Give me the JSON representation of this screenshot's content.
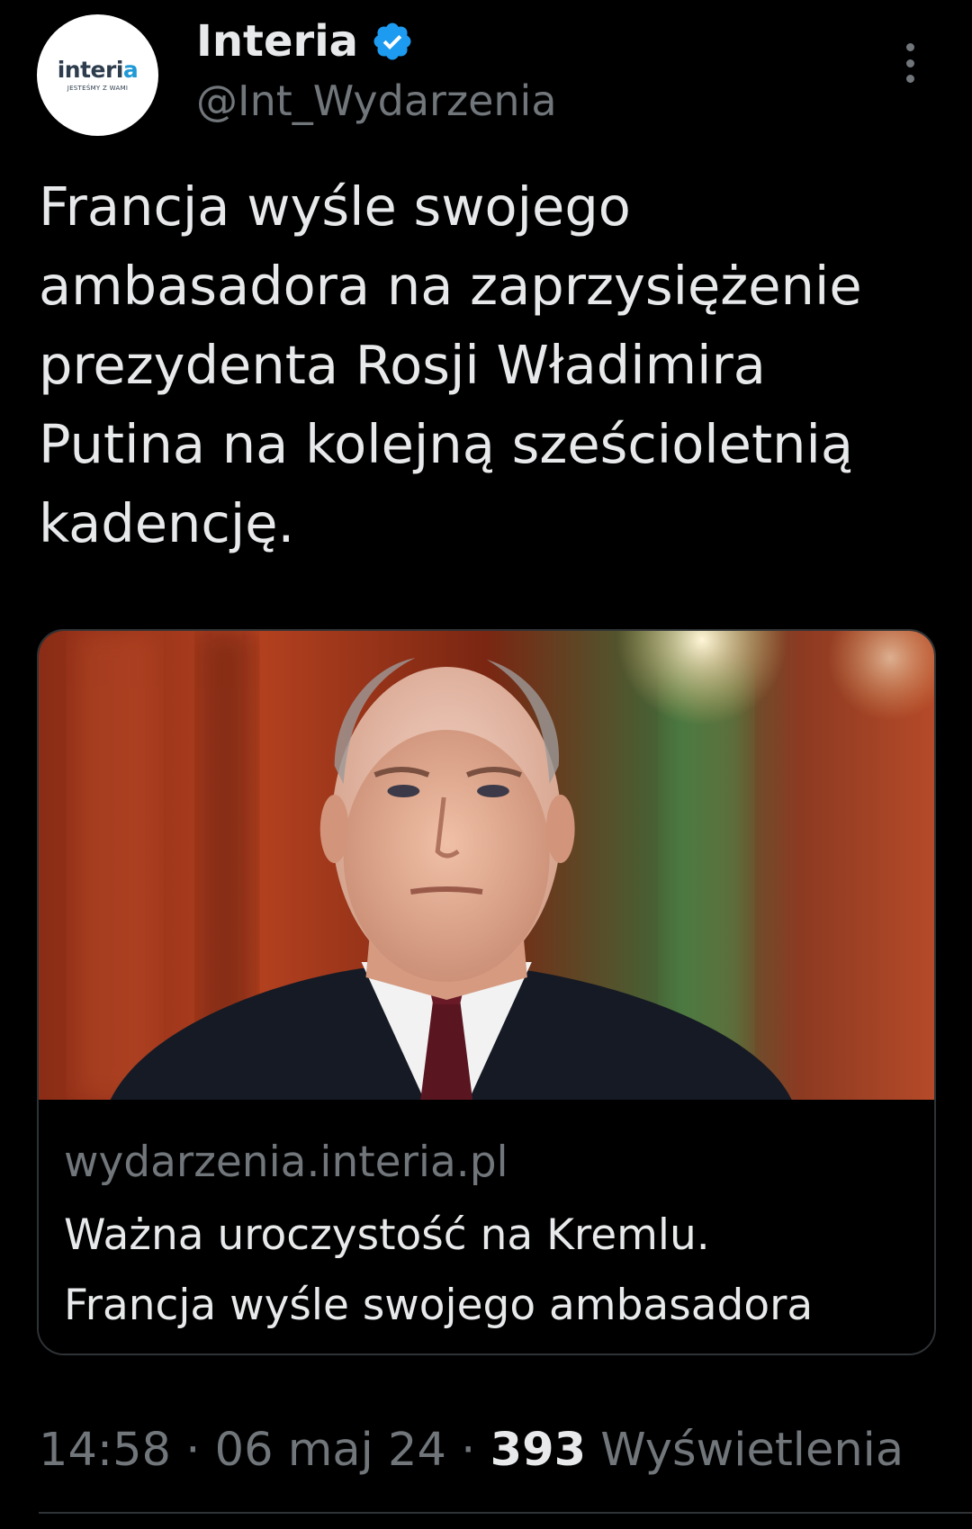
{
  "author": {
    "avatar_logo_main": "interi",
    "avatar_logo_accent": "a",
    "avatar_tagline": "JESTEŚMY Z WAMI",
    "display_name": "Interia",
    "verified": true,
    "handle": "@Int_Wydarzenia"
  },
  "tweet": {
    "text_lines": [
      "Francja wyśle swojego",
      "ambasadora na zaprzysiężenie",
      "prezydenta Rosji Władimira",
      "Putina na kolejną sześcioletnią",
      "kadencję."
    ]
  },
  "card": {
    "domain": "wydarzenia.interia.pl",
    "title_lines": [
      "Ważna uroczystość na Kremlu.",
      "Francja wyśle swojego ambasadora"
    ]
  },
  "meta": {
    "time": "14:58",
    "separator": " · ",
    "date": "06 maj 24",
    "views_count": "393",
    "views_label": " Wyświetlenia"
  },
  "icons": {
    "verified_badge": "verified-badge-icon",
    "more": "more-vertical-icon"
  },
  "colors": {
    "background": "#000000",
    "text_primary": "#e7e9ea",
    "text_secondary": "#71767b",
    "verified_blue": "#1d9bf0",
    "border": "#2f3336"
  }
}
